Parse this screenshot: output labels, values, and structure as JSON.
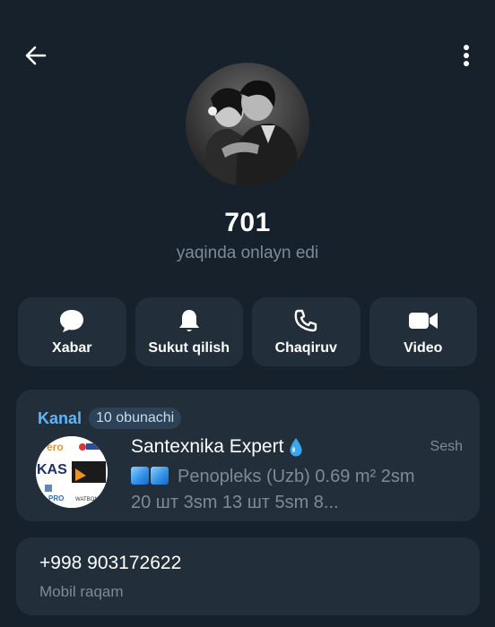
{
  "topbar": {
    "back_icon": "arrow-left-icon",
    "menu_icon": "more-vertical-icon"
  },
  "profile": {
    "name": "701",
    "status": "yaqinda onlayn edi"
  },
  "actions": [
    {
      "label": "Xabar",
      "icon": "message-bubble-icon"
    },
    {
      "label": "Sukut qilish",
      "icon": "bell-icon"
    },
    {
      "label": "Chaqiruv",
      "icon": "phone-icon"
    },
    {
      "label": "Video",
      "icon": "video-camera-icon"
    }
  ],
  "channel": {
    "section_label": "Kanal",
    "subscribers": "10 obunachi",
    "title": "Santexnika Expert",
    "time": "Sesh",
    "preview_line1": "Penopleks (Uzb)  0.69 m²  2sm",
    "preview_line2": "20 шт 3sm  13 шт 5sm   8...",
    "logo_texts": [
      "ero",
      "KAS",
      "PRO",
      "WATBON"
    ]
  },
  "contact": {
    "phone": "+998 903172622",
    "phone_label": "Mobil raqam"
  },
  "colors": {
    "background": "#17212b",
    "card": "#222f3b",
    "accent": "#5eb5f7",
    "muted_text": "#7d8b99"
  }
}
